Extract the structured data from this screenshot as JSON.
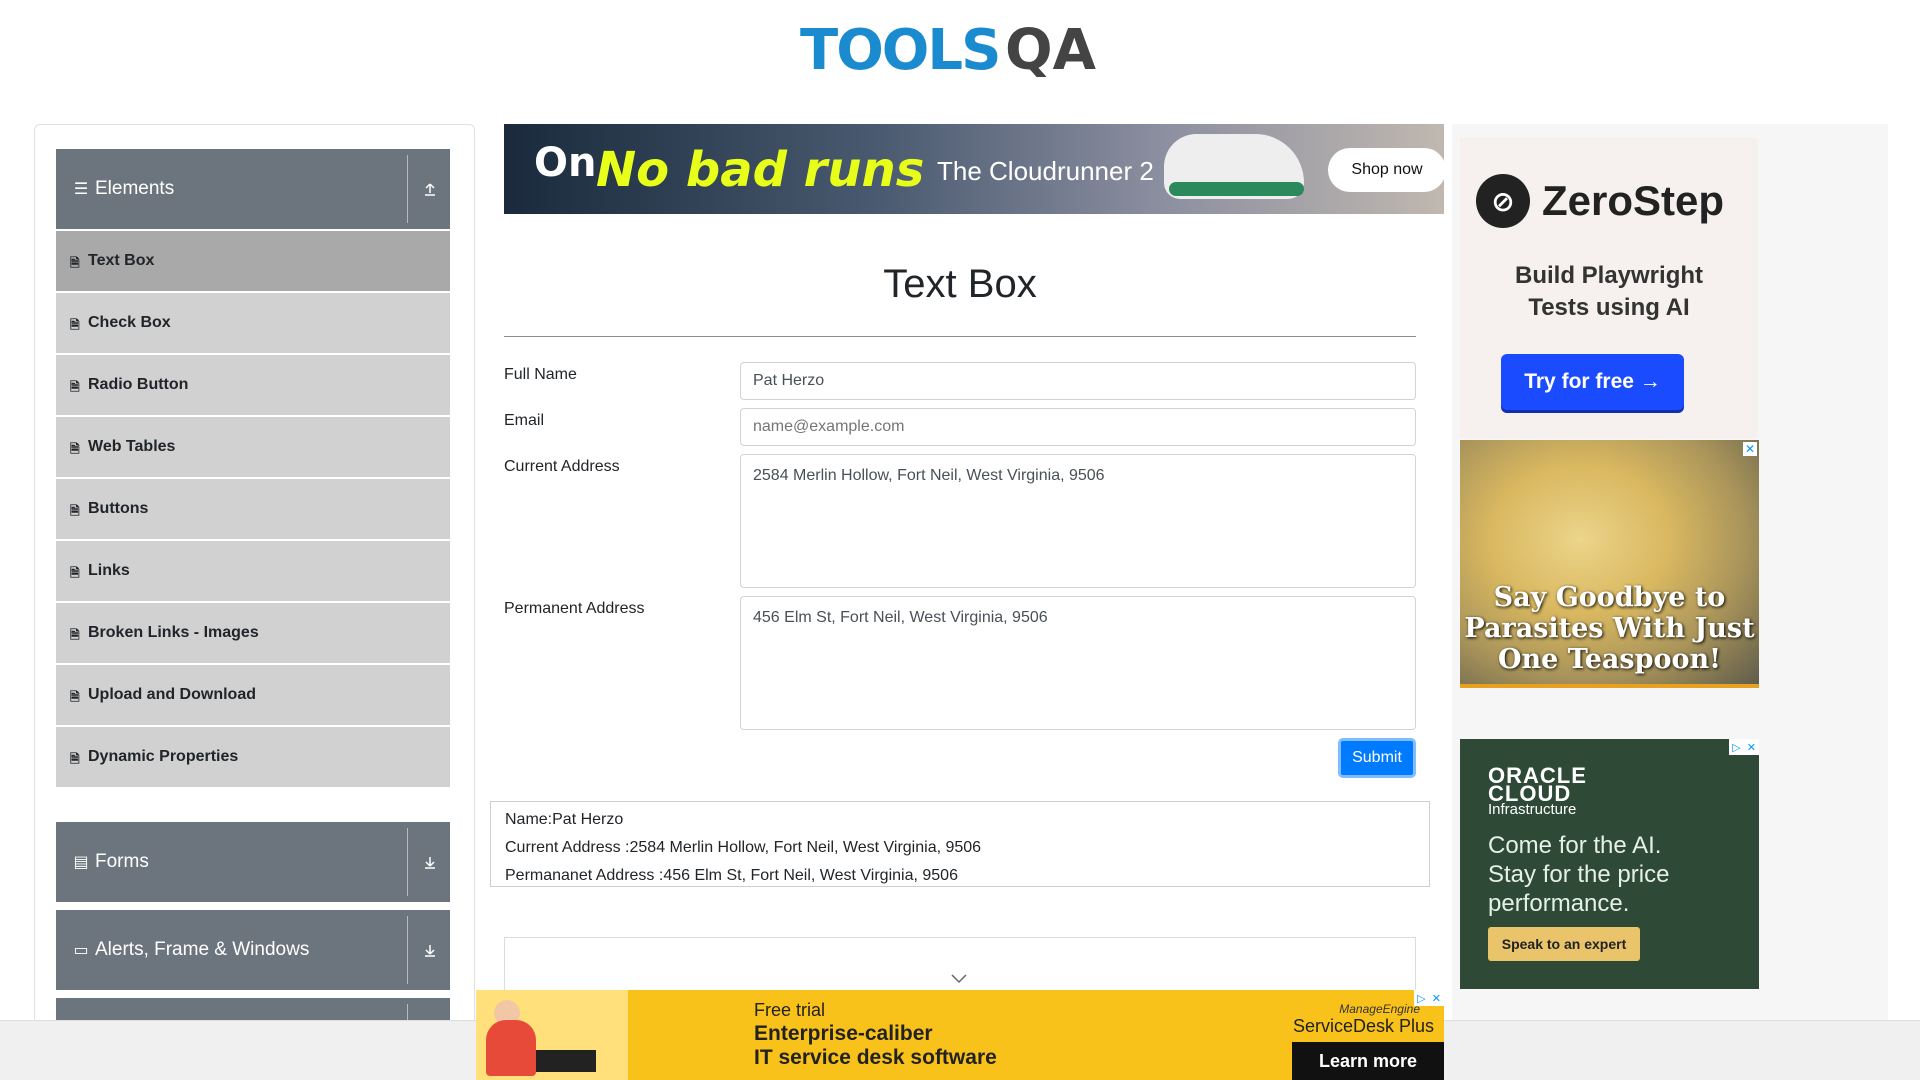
{
  "header": {
    "logo_text": "TOOLS",
    "logo_qa": "QA"
  },
  "sidebar": {
    "elements_group": {
      "label": "Elements",
      "items": [
        "Text Box",
        "Check Box",
        "Radio Button",
        "Web Tables",
        "Buttons",
        "Links",
        "Broken Links - Images",
        "Upload and Download",
        "Dynamic Properties"
      ],
      "active_index": 0
    },
    "forms_group": {
      "label": "Forms"
    },
    "alerts_group": {
      "label": "Alerts, Frame & Windows"
    }
  },
  "top_ad": {
    "brand": "On",
    "slogan": "No bad runs",
    "product": "The Cloudrunner 2",
    "cta": "Shop now"
  },
  "main": {
    "title": "Text Box",
    "full_name_label": "Full Name",
    "full_name_value": "Pat Herzo",
    "email_label": "Email",
    "email_placeholder": "name@example.com",
    "current_address_label": "Current Address",
    "current_address_value": "2584 Merlin Hollow, Fort Neil, West Virginia, 9506",
    "permanent_address_label": "Permanent Address",
    "permanent_address_value": "456 Elm St, Fort Neil, West Virginia, 9506",
    "submit_label": "Submit",
    "output": {
      "name": "Name:Pat Herzo",
      "current_address": "Current Address :2584 Merlin Hollow, Fort Neil, West Virginia, 9506",
      "permanent_address": "Permananet Address :456 Elm St, Fort Neil, West Virginia, 9506"
    }
  },
  "right_ads": {
    "zerostep": {
      "brand": "ZeroStep",
      "line1": "Build Playwright",
      "line2": "Tests using AI",
      "cta": "Try for free →"
    },
    "parasite": {
      "line1": "Say Goodbye to",
      "line2": "Parasites With Just",
      "line3": "One Teaspoon!"
    },
    "oracle": {
      "brand1": "ORACLE",
      "brand2": "CLOUD",
      "brand_sub": "Infrastructure",
      "msg1": "Come for the AI.",
      "msg2": "Stay for the price",
      "msg3": "performance.",
      "cta": "Speak to an expert"
    }
  },
  "bottom_ad": {
    "line1": "Free trial",
    "line2": "Enterprise-caliber",
    "line3": "IT service desk software",
    "brand_small": "ManageEngine",
    "brand": "ServiceDesk Plus",
    "cta": "Learn more"
  },
  "colors": {
    "brand_blue": "#1b8bd0",
    "sidebar_header": "#6c757d",
    "submit": "#007bff"
  }
}
